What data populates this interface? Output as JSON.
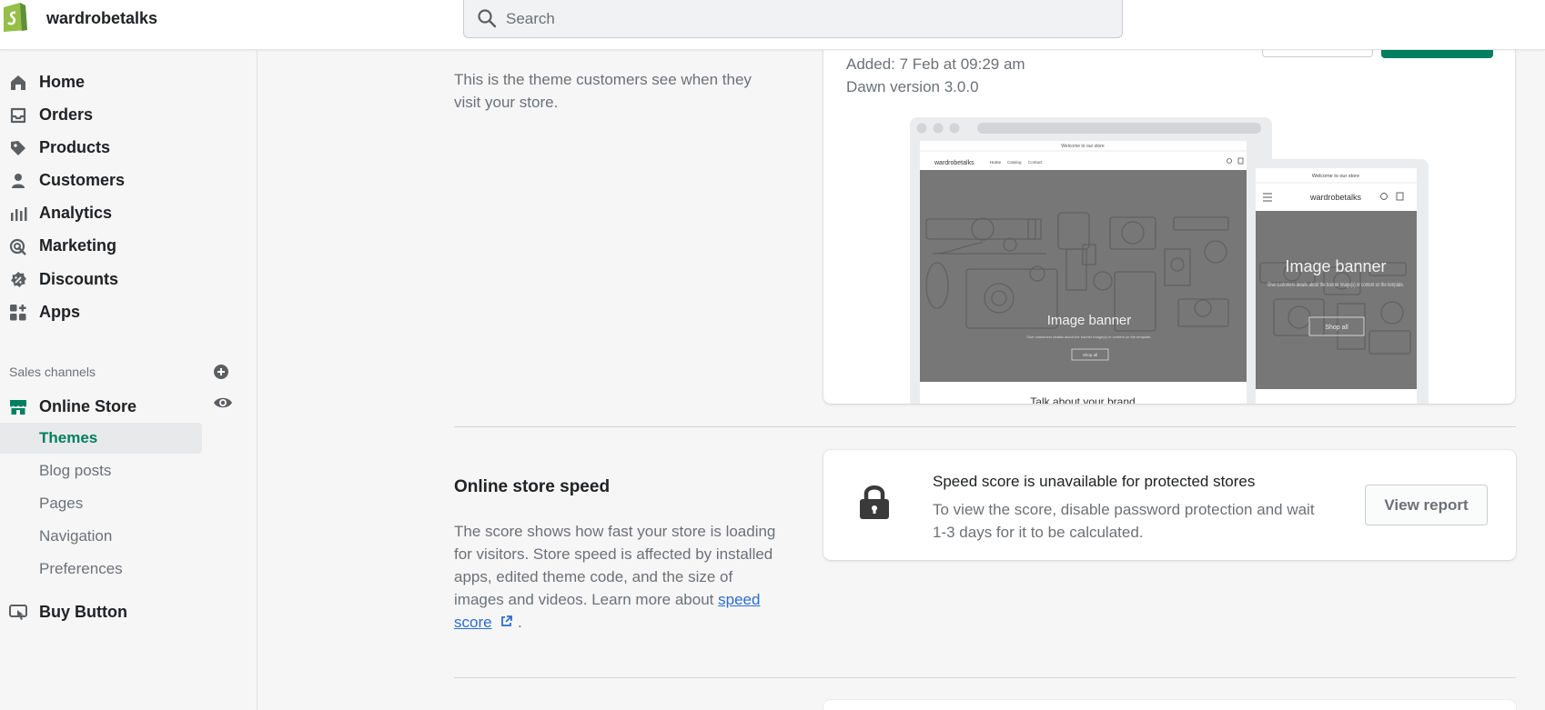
{
  "header": {
    "store_name": "wardrobetalks",
    "search_placeholder": "Search"
  },
  "sidebar": {
    "items": [
      {
        "label": "Home",
        "icon": "home-icon"
      },
      {
        "label": "Orders",
        "icon": "inbox-icon"
      },
      {
        "label": "Products",
        "icon": "tag-icon"
      },
      {
        "label": "Customers",
        "icon": "person-icon"
      },
      {
        "label": "Analytics",
        "icon": "bar-chart-icon"
      },
      {
        "label": "Marketing",
        "icon": "target-icon"
      },
      {
        "label": "Discounts",
        "icon": "discount-icon"
      },
      {
        "label": "Apps",
        "icon": "apps-icon"
      }
    ],
    "sales_channels_label": "Sales channels",
    "online_store": "Online Store",
    "sub_items": [
      "Themes",
      "Blog posts",
      "Pages",
      "Navigation",
      "Preferences"
    ],
    "active_sub_item": "Themes",
    "buy_button": "Buy Button"
  },
  "theme": {
    "description": "This is the theme customers see when they visit your store.",
    "added": "Added: 7 Feb at 09:29 am",
    "version": "Dawn version 3.0.0",
    "preview": {
      "announcement": "Welcome to our store",
      "store_name": "wardrobetalks",
      "nav": [
        "Home",
        "Catalog",
        "Contact"
      ],
      "banner_title": "Image banner",
      "banner_text": "Give customers details about the banner image(s) or content on the template.",
      "button": "Shop all",
      "below_banner": "Talk about your brand"
    }
  },
  "speed": {
    "title": "Online store speed",
    "description": "The score shows how fast your store is loading for visitors. Store speed is affected by installed apps, edited theme code, and the size of images and videos. Learn more about",
    "link": "speed score",
    "link_suffix": ".",
    "card_heading": "Speed score is unavailable for protected stores",
    "card_body": "To view the score, disable password protection and wait 1-3 days for it to be calculated.",
    "view_report": "View report"
  },
  "colors": {
    "accent": "#008060",
    "link": "#2c6ecb",
    "background": "#f6f6f7"
  }
}
